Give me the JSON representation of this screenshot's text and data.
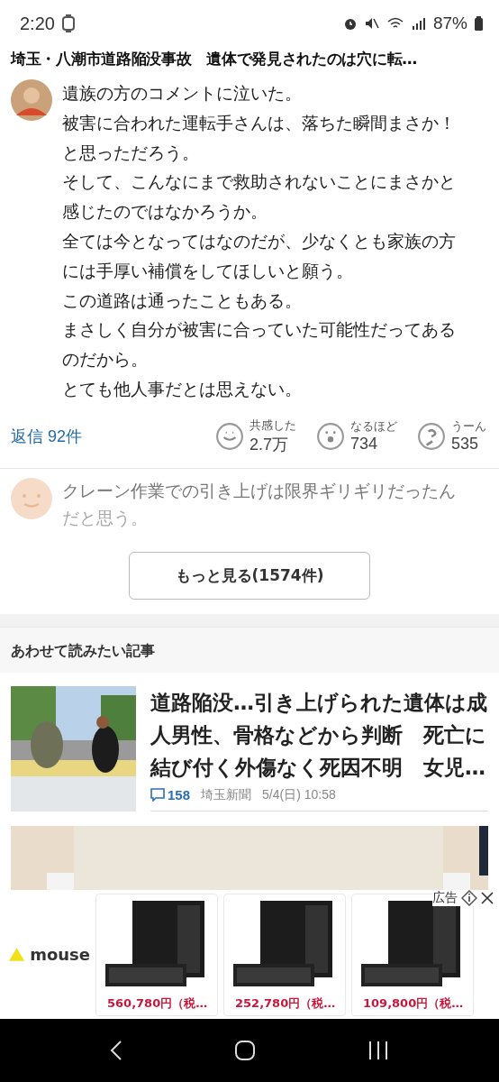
{
  "status_bar": {
    "time": "2:20",
    "battery": "87%"
  },
  "article_title": "埼玉・八潮市道路陥没事故　遺体で発見されたのは穴に転…",
  "comment": {
    "lines": [
      "遺族の方のコメントに泣いた。",
      "被害に合われた運転手さんは、落ちた瞬間まさか！",
      "と思っただろう。",
      "そして、こんなにまで救助されないことにまさかと",
      "感じたのではなかろうか。",
      "全ては今となってはなのだが、少なくとも家族の方",
      "には手厚い補償をしてほしいと願う。",
      "この道路は通ったこともある。",
      "まさしく自分が被害に合っていた可能性だってある",
      "のだから。",
      "とても他人事だとは思えない。"
    ],
    "replies": "返信 92件",
    "reactions": [
      {
        "kind": "smile",
        "label": "共感した",
        "count": "2.7万"
      },
      {
        "kind": "surprised",
        "label": "なるほど",
        "count": "734"
      },
      {
        "kind": "thinking",
        "label": "うーん",
        "count": "535"
      }
    ]
  },
  "next_comment": {
    "lines": [
      "クレーン作業での引き上げは限界ギリギリだったん",
      "だと思う。"
    ]
  },
  "more_button": "もっと見る(1574件)",
  "related": {
    "heading": "あわせて読みたい記事",
    "articles": [
      {
        "title": "道路陥没…引き上げられた遺体は成人男性、骨格などから判断　死亡に結び付く外傷なく死因不明　女児…",
        "comments": "158",
        "source": "埼玉新聞",
        "date": "5/4(日) 10:58"
      }
    ]
  },
  "ad": {
    "brand": "mouse",
    "label": "広告",
    "products": [
      {
        "price": "560,780円（税…"
      },
      {
        "price": "252,780円（税…"
      },
      {
        "price": "109,800円（税…"
      }
    ]
  }
}
